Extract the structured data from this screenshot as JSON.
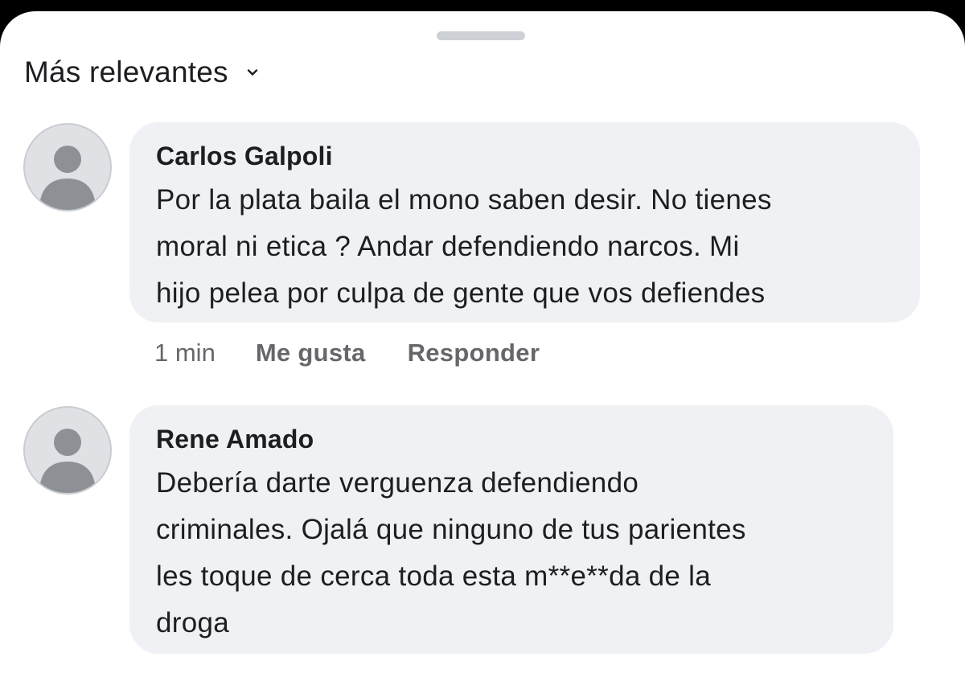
{
  "sort": {
    "label": "Más relevantes",
    "icon": "chevron-down-icon"
  },
  "comments": [
    {
      "author": "Carlos Galpoli",
      "text_lines": [
        "Por la plata baila el mono saben desir. No tienes",
        "moral ni etica ? Andar defendiendo narcos. Mi",
        "hijo pelea por culpa de gente que vos defiendes"
      ],
      "time": "1 min",
      "like_label": "Me gusta",
      "reply_label": "Responder"
    },
    {
      "author": "Rene Amado",
      "text_lines": [
        "Debería darte verguenza defendiendo",
        "criminales. Ojalá que ninguno de tus parientes",
        "les toque de cerca toda esta m**e**da de la",
        "droga"
      ]
    }
  ],
  "colors": {
    "bubble": "#eff1f4",
    "text": "#1c1e21",
    "meta": "#65676b",
    "avatar_bg": "#dfe1e5",
    "avatar_figure": "#8d9094"
  }
}
